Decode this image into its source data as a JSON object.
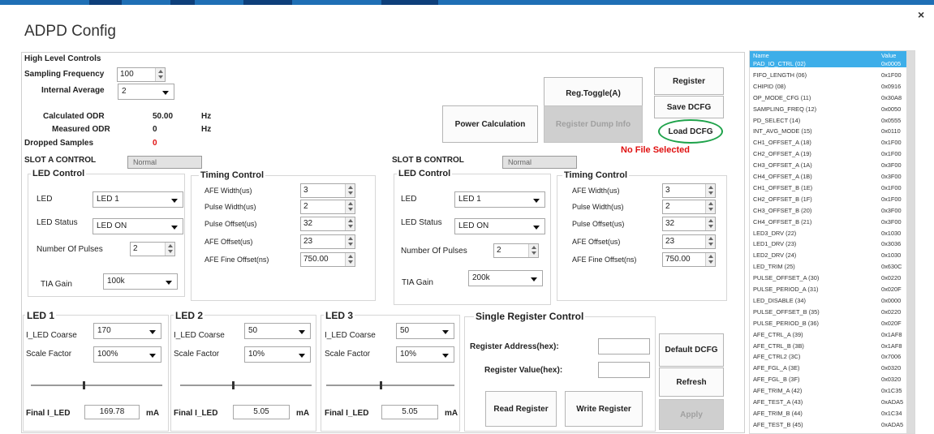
{
  "window": {
    "title": "ADPD Config",
    "close_label": "×"
  },
  "high_level": {
    "title": "High Level Controls",
    "sampling_label": "Sampling Frequency",
    "sampling_value": "100",
    "internal_avg_label": "Internal Average",
    "internal_avg_value": "2",
    "calc_odr_label": "Calculated ODR",
    "calc_odr_value": "50.00",
    "calc_odr_unit": "Hz",
    "measured_odr_label": "Measured ODR",
    "measured_odr_value": "0",
    "measured_odr_unit": "Hz",
    "dropped_label": "Dropped Samples",
    "dropped_value": "0"
  },
  "buttons": {
    "reg_toggle": "Reg.Toggle(A)",
    "register": "Register",
    "save_dcfg": "Save DCFG",
    "power_calc": "Power Calculation",
    "reg_dump": "Register Dump Info",
    "load_dcfg": "Load DCFG",
    "default_dcfg": "Default DCFG",
    "refresh": "Refresh",
    "apply": "Apply",
    "read_register": "Read Register",
    "write_register": "Write Register"
  },
  "no_file": "No File Selected",
  "slot_a": {
    "title": "SLOT A CONTROL",
    "status": "Normal",
    "led_control_title": "LED Control",
    "led_label": "LED",
    "led_value": "LED 1",
    "led_status_label": "LED Status",
    "led_status_value": "LED ON",
    "pulses_label": "Number Of Pulses",
    "pulses_value": "2",
    "tia_label": "TIA Gain",
    "tia_value": "100k",
    "timing_title": "Timing Control",
    "afe_width_label": "AFE Width(us)",
    "afe_width_value": "3",
    "pulse_width_label": "Pulse Width(us)",
    "pulse_width_value": "2",
    "pulse_offset_label": "Pulse Offset(us)",
    "pulse_offset_value": "32",
    "afe_offset_label": "AFE Offset(us)",
    "afe_offset_value": "23",
    "afe_fine_label": "AFE Fine Offset(ns)",
    "afe_fine_value": "750.00"
  },
  "slot_b": {
    "title": "SLOT B CONTROL",
    "status": "Normal",
    "led_control_title": "LED Control",
    "led_label": "LED",
    "led_value": "LED 1",
    "led_status_label": "LED Status",
    "led_status_value": "LED ON",
    "pulses_label": "Number Of Pulses",
    "pulses_value": "2",
    "tia_label": "TIA Gain",
    "tia_value": "200k",
    "timing_title": "Timing Control",
    "afe_width_label": "AFE Width(us)",
    "afe_width_value": "3",
    "pulse_width_label": "Pulse Width(us)",
    "pulse_width_value": "2",
    "pulse_offset_label": "Pulse Offset(us)",
    "pulse_offset_value": "32",
    "afe_offset_label": "AFE Offset(us)",
    "afe_offset_value": "23",
    "afe_fine_label": "AFE Fine Offset(ns)",
    "afe_fine_value": "750.00"
  },
  "led1": {
    "title": "LED 1",
    "coarse_label": "I_LED Coarse",
    "coarse_value": "170",
    "scale_label": "Scale Factor",
    "scale_value": "100%",
    "final_label": "Final I_LED",
    "final_value": "169.78",
    "unit": "mA"
  },
  "led2": {
    "title": "LED 2",
    "coarse_label": "I_LED Coarse",
    "coarse_value": "50",
    "scale_label": "Scale Factor",
    "scale_value": "10%",
    "final_label": "Final I_LED",
    "final_value": "5.05",
    "unit": "mA"
  },
  "led3": {
    "title": "LED 3",
    "coarse_label": "I_LED Coarse",
    "coarse_value": "50",
    "scale_label": "Scale Factor",
    "scale_value": "10%",
    "final_label": "Final I_LED",
    "final_value": "5.05",
    "unit": "mA"
  },
  "single_reg": {
    "title": "Single Register Control",
    "address_label": "Register Address(hex):",
    "address_value": "",
    "value_label": "Register Value(hex):",
    "value_value": ""
  },
  "register_list": {
    "col_name": "Name",
    "col_value": "Value",
    "rows": [
      [
        "PAD_IO_CTRL (02)",
        "0x0005"
      ],
      [
        "FIFO_LENGTH (06)",
        "0x1F00"
      ],
      [
        "CHIPID (08)",
        "0x0916"
      ],
      [
        "OP_MODE_CFG (11)",
        "0x30A8"
      ],
      [
        "SAMPLING_FREQ (12)",
        "0x0050"
      ],
      [
        "PD_SELECT (14)",
        "0x0555"
      ],
      [
        "INT_AVG_MODE (15)",
        "0x0110"
      ],
      [
        "CH1_OFFSET_A (18)",
        "0x1F00"
      ],
      [
        "CH2_OFFSET_A (19)",
        "0x1F00"
      ],
      [
        "CH3_OFFSET_A (1A)",
        "0x3F00"
      ],
      [
        "CH4_OFFSET_A (1B)",
        "0x3F00"
      ],
      [
        "CH1_OFFSET_B (1E)",
        "0x1F00"
      ],
      [
        "CH2_OFFSET_B (1F)",
        "0x1F00"
      ],
      [
        "CH3_OFFSET_B (20)",
        "0x3F00"
      ],
      [
        "CH4_OFFSET_B (21)",
        "0x3F00"
      ],
      [
        "LED3_DRV (22)",
        "0x1030"
      ],
      [
        "LED1_DRV (23)",
        "0x3036"
      ],
      [
        "LED2_DRV (24)",
        "0x1030"
      ],
      [
        "LED_TRIM (25)",
        "0x630C"
      ],
      [
        "PULSE_OFFSET_A (30)",
        "0x0220"
      ],
      [
        "PULSE_PERIOD_A (31)",
        "0x020F"
      ],
      [
        "LED_DISABLE (34)",
        "0x0000"
      ],
      [
        "PULSE_OFFSET_B (35)",
        "0x0220"
      ],
      [
        "PULSE_PERIOD_B (36)",
        "0x020F"
      ],
      [
        "AFE_CTRL_A (39)",
        "0x1AF8"
      ],
      [
        "AFE_CTRL_B (3B)",
        "0x1AF8"
      ],
      [
        "AFE_CTRL2 (3C)",
        "0x7006"
      ],
      [
        "AFE_FGL_A (3E)",
        "0x0320"
      ],
      [
        "AFE_FGL_B (3F)",
        "0x0320"
      ],
      [
        "AFE_TRIM_A (42)",
        "0x1C35"
      ],
      [
        "AFE_TEST_A (43)",
        "0xADA5"
      ],
      [
        "AFE_TRIM_B (44)",
        "0x1C34"
      ],
      [
        "AFE_TEST_B (45)",
        "0xADA5"
      ]
    ]
  }
}
